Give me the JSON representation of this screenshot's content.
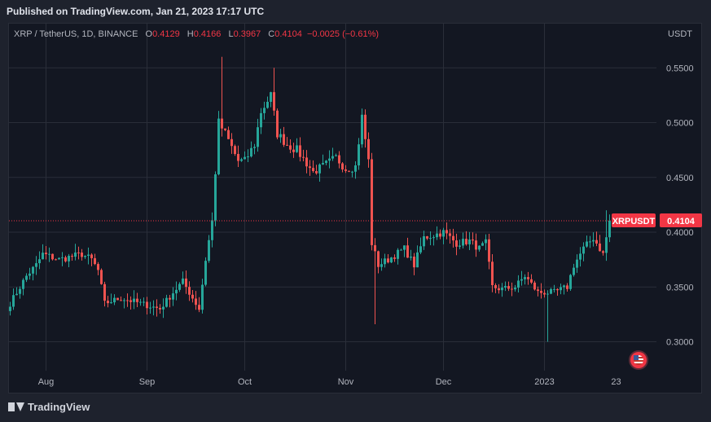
{
  "header": {
    "published": "Published on TradingView.com, Jan 21, 2023 17:17 UTC"
  },
  "legend": {
    "symbol": "XRP / TetherUS, 1D, BINANCE",
    "o_label": "O",
    "o_value": "0.4129",
    "h_label": "H",
    "h_value": "0.4166",
    "l_label": "L",
    "l_value": "0.3967",
    "c_label": "C",
    "c_value": "0.4104",
    "change": "−0.0025 (−0.61%)"
  },
  "currency": "USDT",
  "last_price": {
    "label": "XRPUSDT",
    "value": "0.4104"
  },
  "footer": {
    "brand": "TradingView"
  },
  "colors": {
    "up": "#26a69a",
    "down": "#ef5350",
    "background": "#131722",
    "grid": "#2a2e39",
    "price_line": "#f23645"
  },
  "chart_data": {
    "type": "candlestick",
    "y_ticks": [
      "0.5500",
      "0.5000",
      "0.4500",
      "0.4000",
      "0.3500",
      "0.3000"
    ],
    "x_ticks": [
      "Aug",
      "Sep",
      "Oct",
      "Nov",
      "Dec",
      "2023",
      "23"
    ],
    "ylim": [
      0.27,
      0.58
    ],
    "grid": true,
    "anchors": [
      [
        "2022-07-21",
        0.335
      ],
      [
        "2022-07-26",
        0.36
      ],
      [
        "2022-07-29",
        0.37
      ],
      [
        "2022-07-31",
        0.38
      ],
      [
        "2022-08-05",
        0.375
      ],
      [
        "2022-08-12",
        0.38
      ],
      [
        "2022-08-15",
        0.375
      ],
      [
        "2022-08-17",
        0.365
      ],
      [
        "2022-08-19",
        0.335
      ],
      [
        "2022-08-24",
        0.34
      ],
      [
        "2022-08-30",
        0.335
      ],
      [
        "2022-09-05",
        0.33
      ],
      [
        "2022-09-09",
        0.345
      ],
      [
        "2022-09-12",
        0.355
      ],
      [
        "2022-09-17",
        0.33
      ],
      [
        "2022-09-19",
        0.375
      ],
      [
        "2022-09-21",
        0.41
      ],
      [
        "2022-09-23",
        0.5
      ],
      [
        "2022-09-25",
        0.49
      ],
      [
        "2022-09-29",
        0.465
      ],
      [
        "2022-10-01",
        0.465
      ],
      [
        "2022-10-04",
        0.48
      ],
      [
        "2022-10-06",
        0.51
      ],
      [
        "2022-10-09",
        0.525
      ],
      [
        "2022-10-11",
        0.49
      ],
      [
        "2022-10-14",
        0.48
      ],
      [
        "2022-10-17",
        0.475
      ],
      [
        "2022-10-22",
        0.455
      ],
      [
        "2022-10-25",
        0.46
      ],
      [
        "2022-10-29",
        0.468
      ],
      [
        "2022-11-01",
        0.458
      ],
      [
        "2022-11-04",
        0.46
      ],
      [
        "2022-11-06",
        0.505
      ],
      [
        "2022-11-08",
        0.465
      ],
      [
        "2022-11-09",
        0.39
      ],
      [
        "2022-11-11",
        0.37
      ],
      [
        "2022-11-14",
        0.375
      ],
      [
        "2022-11-19",
        0.385
      ],
      [
        "2022-11-22",
        0.37
      ],
      [
        "2022-11-25",
        0.395
      ],
      [
        "2022-12-01",
        0.4
      ],
      [
        "2022-12-05",
        0.39
      ],
      [
        "2022-12-09",
        0.392
      ],
      [
        "2022-12-12",
        0.385
      ],
      [
        "2022-12-14",
        0.39
      ],
      [
        "2022-12-16",
        0.35
      ],
      [
        "2022-12-19",
        0.348
      ],
      [
        "2022-12-23",
        0.35
      ],
      [
        "2022-12-26",
        0.36
      ],
      [
        "2022-12-30",
        0.345
      ],
      [
        "2023-01-04",
        0.345
      ],
      [
        "2023-01-08",
        0.35
      ],
      [
        "2023-01-10",
        0.37
      ],
      [
        "2023-01-13",
        0.385
      ],
      [
        "2023-01-16",
        0.395
      ],
      [
        "2023-01-19",
        0.38
      ],
      [
        "2023-01-21",
        0.4104
      ]
    ],
    "spikes": [
      [
        "2022-09-24",
        0.56,
        "high"
      ],
      [
        "2022-10-10",
        0.55,
        "high"
      ],
      [
        "2022-11-10",
        0.316,
        "low"
      ],
      [
        "2023-01-02",
        0.3,
        "low"
      ],
      [
        "2023-01-20",
        0.42,
        "high"
      ]
    ]
  }
}
